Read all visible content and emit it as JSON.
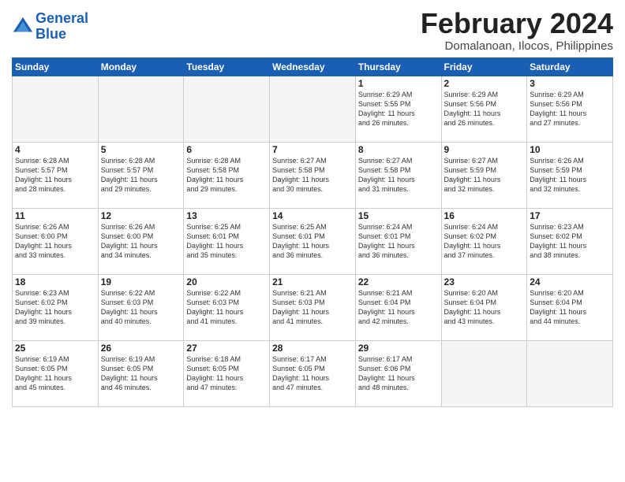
{
  "logo": {
    "line1": "General",
    "line2": "Blue"
  },
  "title": "February 2024",
  "subtitle": "Domalanoan, Ilocos, Philippines",
  "weekdays": [
    "Sunday",
    "Monday",
    "Tuesday",
    "Wednesday",
    "Thursday",
    "Friday",
    "Saturday"
  ],
  "weeks": [
    [
      {
        "day": "",
        "info": ""
      },
      {
        "day": "",
        "info": ""
      },
      {
        "day": "",
        "info": ""
      },
      {
        "day": "",
        "info": ""
      },
      {
        "day": "1",
        "info": "Sunrise: 6:29 AM\nSunset: 5:55 PM\nDaylight: 11 hours\nand 26 minutes."
      },
      {
        "day": "2",
        "info": "Sunrise: 6:29 AM\nSunset: 5:56 PM\nDaylight: 11 hours\nand 26 minutes."
      },
      {
        "day": "3",
        "info": "Sunrise: 6:29 AM\nSunset: 5:56 PM\nDaylight: 11 hours\nand 27 minutes."
      }
    ],
    [
      {
        "day": "4",
        "info": "Sunrise: 6:28 AM\nSunset: 5:57 PM\nDaylight: 11 hours\nand 28 minutes."
      },
      {
        "day": "5",
        "info": "Sunrise: 6:28 AM\nSunset: 5:57 PM\nDaylight: 11 hours\nand 29 minutes."
      },
      {
        "day": "6",
        "info": "Sunrise: 6:28 AM\nSunset: 5:58 PM\nDaylight: 11 hours\nand 29 minutes."
      },
      {
        "day": "7",
        "info": "Sunrise: 6:27 AM\nSunset: 5:58 PM\nDaylight: 11 hours\nand 30 minutes."
      },
      {
        "day": "8",
        "info": "Sunrise: 6:27 AM\nSunset: 5:58 PM\nDaylight: 11 hours\nand 31 minutes."
      },
      {
        "day": "9",
        "info": "Sunrise: 6:27 AM\nSunset: 5:59 PM\nDaylight: 11 hours\nand 32 minutes."
      },
      {
        "day": "10",
        "info": "Sunrise: 6:26 AM\nSunset: 5:59 PM\nDaylight: 11 hours\nand 32 minutes."
      }
    ],
    [
      {
        "day": "11",
        "info": "Sunrise: 6:26 AM\nSunset: 6:00 PM\nDaylight: 11 hours\nand 33 minutes."
      },
      {
        "day": "12",
        "info": "Sunrise: 6:26 AM\nSunset: 6:00 PM\nDaylight: 11 hours\nand 34 minutes."
      },
      {
        "day": "13",
        "info": "Sunrise: 6:25 AM\nSunset: 6:01 PM\nDaylight: 11 hours\nand 35 minutes."
      },
      {
        "day": "14",
        "info": "Sunrise: 6:25 AM\nSunset: 6:01 PM\nDaylight: 11 hours\nand 36 minutes."
      },
      {
        "day": "15",
        "info": "Sunrise: 6:24 AM\nSunset: 6:01 PM\nDaylight: 11 hours\nand 36 minutes."
      },
      {
        "day": "16",
        "info": "Sunrise: 6:24 AM\nSunset: 6:02 PM\nDaylight: 11 hours\nand 37 minutes."
      },
      {
        "day": "17",
        "info": "Sunrise: 6:23 AM\nSunset: 6:02 PM\nDaylight: 11 hours\nand 38 minutes."
      }
    ],
    [
      {
        "day": "18",
        "info": "Sunrise: 6:23 AM\nSunset: 6:02 PM\nDaylight: 11 hours\nand 39 minutes."
      },
      {
        "day": "19",
        "info": "Sunrise: 6:22 AM\nSunset: 6:03 PM\nDaylight: 11 hours\nand 40 minutes."
      },
      {
        "day": "20",
        "info": "Sunrise: 6:22 AM\nSunset: 6:03 PM\nDaylight: 11 hours\nand 41 minutes."
      },
      {
        "day": "21",
        "info": "Sunrise: 6:21 AM\nSunset: 6:03 PM\nDaylight: 11 hours\nand 41 minutes."
      },
      {
        "day": "22",
        "info": "Sunrise: 6:21 AM\nSunset: 6:04 PM\nDaylight: 11 hours\nand 42 minutes."
      },
      {
        "day": "23",
        "info": "Sunrise: 6:20 AM\nSunset: 6:04 PM\nDaylight: 11 hours\nand 43 minutes."
      },
      {
        "day": "24",
        "info": "Sunrise: 6:20 AM\nSunset: 6:04 PM\nDaylight: 11 hours\nand 44 minutes."
      }
    ],
    [
      {
        "day": "25",
        "info": "Sunrise: 6:19 AM\nSunset: 6:05 PM\nDaylight: 11 hours\nand 45 minutes."
      },
      {
        "day": "26",
        "info": "Sunrise: 6:19 AM\nSunset: 6:05 PM\nDaylight: 11 hours\nand 46 minutes."
      },
      {
        "day": "27",
        "info": "Sunrise: 6:18 AM\nSunset: 6:05 PM\nDaylight: 11 hours\nand 47 minutes."
      },
      {
        "day": "28",
        "info": "Sunrise: 6:17 AM\nSunset: 6:05 PM\nDaylight: 11 hours\nand 47 minutes."
      },
      {
        "day": "29",
        "info": "Sunrise: 6:17 AM\nSunset: 6:06 PM\nDaylight: 11 hours\nand 48 minutes."
      },
      {
        "day": "",
        "info": ""
      },
      {
        "day": "",
        "info": ""
      }
    ]
  ]
}
